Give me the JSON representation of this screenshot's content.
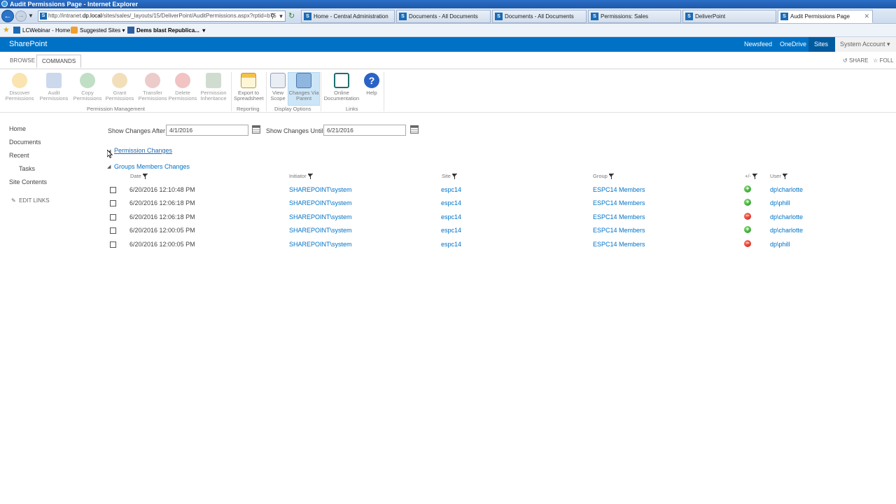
{
  "browser": {
    "window_title": "Audit Permissions Page - Internet Explorer",
    "address_prefix": "http://intranet.",
    "address_domain": "dp.local",
    "address_rest": "/sites/sales/_layouts/15/DeliverPoint/AuditPermissions.aspx?rptid=b75",
    "tabs": [
      {
        "label": "Home - Central Administration"
      },
      {
        "label": "Documents - All Documents"
      },
      {
        "label": "Documents - All Documents"
      },
      {
        "label": "Permissions: Sales"
      },
      {
        "label": "DeliverPoint"
      },
      {
        "label": "Audit Permissions Page"
      }
    ],
    "favorites": [
      {
        "label": "LCWebinar - Home"
      },
      {
        "label": "Suggested Sites"
      },
      {
        "label": "Dems blast Republica..."
      }
    ]
  },
  "suitebar": {
    "brand": "SharePoint",
    "links": [
      "Newsfeed",
      "OneDrive",
      "Sites"
    ],
    "account": "System Account"
  },
  "ribbon": {
    "tabs": [
      "BROWSE",
      "COMMANDS"
    ],
    "share": "SHARE",
    "follow": "FOLL",
    "buttons": {
      "discover": [
        "Discover",
        "Permissions"
      ],
      "audit": [
        "Audit",
        "Permissions"
      ],
      "copy": [
        "Copy",
        "Permissions"
      ],
      "grant": [
        "Grant",
        "Permissions"
      ],
      "transfer": [
        "Transfer",
        "Permissions"
      ],
      "delete": [
        "Delete",
        "Permissions"
      ],
      "inheritance": [
        "Permission",
        "Inheritance"
      ],
      "export": [
        "Export to",
        "Spreadsheet"
      ],
      "view_scope": [
        "View",
        "Scope"
      ],
      "changes_via": [
        "Changes Via",
        "Parent"
      ],
      "online_doc": [
        "Online",
        "Documentation"
      ],
      "help": [
        "Help"
      ]
    },
    "groups": [
      "Permission Management",
      "Reporting",
      "Display Options",
      "Links"
    ]
  },
  "leftnav": {
    "items": [
      "Home",
      "Documents",
      "Recent",
      "Tasks",
      "Site Contents"
    ],
    "edit_links": "EDIT LINKS"
  },
  "filters": {
    "after_label": "Show Changes After",
    "after_value": "4/1/2016",
    "until_label": "Show Changes Until",
    "until_value": "6/21/2016"
  },
  "tree": {
    "permission_changes": "Permission Changes",
    "group_members_changes": "Groups Members Changes"
  },
  "table": {
    "headers": [
      "Date",
      "Initiator",
      "Site",
      "Group",
      "+/-",
      "User"
    ],
    "rows": [
      {
        "date": "6/20/2016 12:10:48 PM",
        "initiator": "SHAREPOINT\\system",
        "site": "espc14",
        "group": "ESPC14 Members",
        "change": "add",
        "user": "dp\\charlotte"
      },
      {
        "date": "6/20/2016 12:06:18 PM",
        "initiator": "SHAREPOINT\\system",
        "site": "espc14",
        "group": "ESPC14 Members",
        "change": "add",
        "user": "dp\\phill"
      },
      {
        "date": "6/20/2016 12:06:18 PM",
        "initiator": "SHAREPOINT\\system",
        "site": "espc14",
        "group": "ESPC14 Members",
        "change": "remove",
        "user": "dp\\charlotte"
      },
      {
        "date": "6/20/2016 12:00:05 PM",
        "initiator": "SHAREPOINT\\system",
        "site": "espc14",
        "group": "ESPC14 Members",
        "change": "add",
        "user": "dp\\charlotte"
      },
      {
        "date": "6/20/2016 12:00:05 PM",
        "initiator": "SHAREPOINT\\system",
        "site": "espc14",
        "group": "ESPC14 Members",
        "change": "remove",
        "user": "dp\\phill"
      }
    ]
  },
  "colors": {
    "suite_blue": "#0072c6",
    "link_blue": "#0072c6",
    "add_green": "#1f8f1f",
    "remove_red": "#c8180f"
  }
}
